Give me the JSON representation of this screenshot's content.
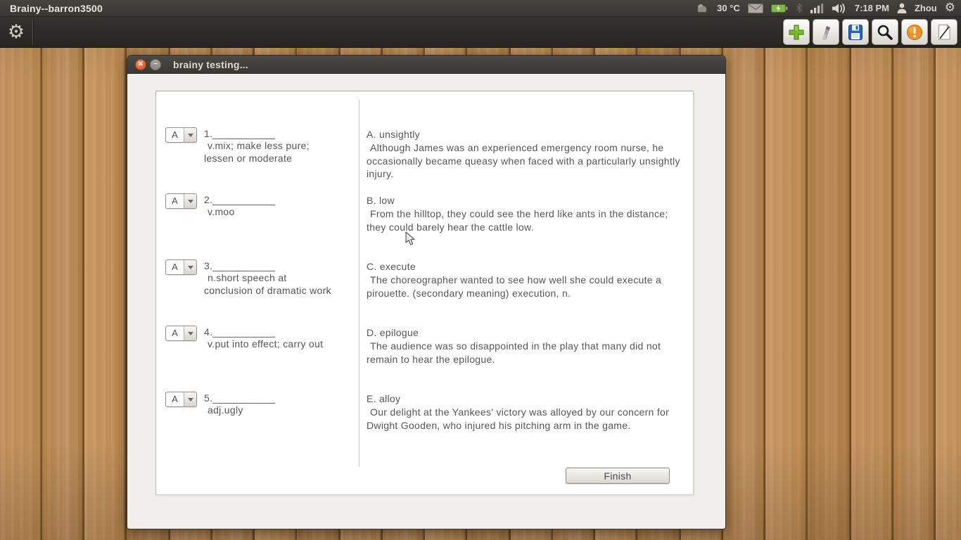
{
  "panel": {
    "title": "Brainy--barron3500",
    "temperature": "30 °C",
    "time": "7:18 PM",
    "username": "Zhou"
  },
  "icons": {
    "panel_tray": [
      "weather-icon",
      "mail-icon",
      "battery-icon",
      "bluetooth-icon",
      "signal-icon",
      "volume-icon",
      "user-icon",
      "gear-icon"
    ],
    "toolbar_left": [
      "gear-icon"
    ],
    "toolbar_right": [
      "add-icon",
      "edit-tool-icon",
      "save-icon",
      "search-icon",
      "alert-icon",
      "note-edit-icon"
    ]
  },
  "colors": {
    "panel_bg": "#3c3a36",
    "accent_add": "#76b82a",
    "accent_save": "#1f66c9",
    "accent_alert": "#e8891a",
    "accent_close": "#ee6536",
    "wood_brown": "#bb8a52"
  },
  "window": {
    "title": "brainy testing...",
    "quiz": {
      "questions": [
        {
          "value": "A",
          "number": "1.",
          "blank": "___________",
          "def_line1": "v.mix; make less pure;",
          "def_line2": "lessen or moderate"
        },
        {
          "value": "A",
          "number": "2.",
          "blank": "___________",
          "def_line1": "v.moo",
          "def_line2": ""
        },
        {
          "value": "A",
          "number": "3.",
          "blank": "___________",
          "def_line1": "n.short speech at",
          "def_line2": "conclusion of dramatic work"
        },
        {
          "value": "A",
          "number": "4.",
          "blank": "___________",
          "def_line1": "v.put into effect; carry out",
          "def_line2": ""
        },
        {
          "value": "A",
          "number": "5.",
          "blank": "___________",
          "def_line1": "adj.ugly",
          "def_line2": ""
        }
      ],
      "answers": [
        {
          "title": "A. unsightly",
          "sentence": "Although James was an experienced emergency room nurse, he occasionally became queasy when faced with a particularly unsightly injury."
        },
        {
          "title": "B. low",
          "sentence": "From the hilltop, they could see the herd like ants in the distance; they could barely hear the cattle low."
        },
        {
          "title": "C. execute",
          "sentence": "The choreographer wanted to see how well she could execute a pirouette. (secondary meaning) execution, n."
        },
        {
          "title": "D. epilogue",
          "sentence": "The audience was so disappointed in the play that many did not remain to hear the epilogue."
        },
        {
          "title": "E. alloy",
          "sentence": "Our delight at the Yankees' victory was alloyed by our concern for Dwight Gooden, who injured his pitching arm in the game."
        }
      ],
      "finish_label": "Finish"
    }
  }
}
